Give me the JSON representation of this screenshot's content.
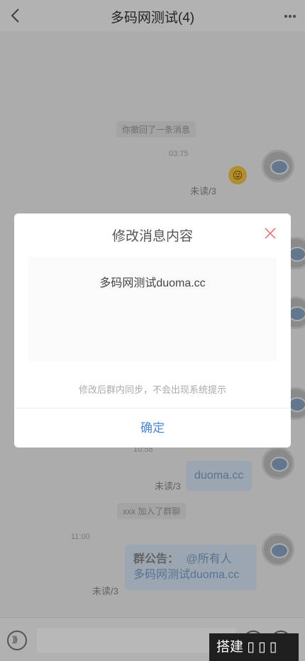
{
  "header": {
    "title": "多码网测试(4)"
  },
  "chat": {
    "system_recall": "你撤回了一条消息",
    "time_1": "03:75",
    "unread_1": "未读/3",
    "emoji_1": "😜",
    "time_2": "10:58",
    "message_2": "duoma.cc",
    "unread_2": "未读/3",
    "system_join": "xxx 加入了群聊",
    "time_3": "11:00",
    "notice_label": "群公告：",
    "notice_mention": "@所有人",
    "notice_text": "多码网测试duoma.cc",
    "unread_3": "未读/3"
  },
  "modal": {
    "title": "修改消息内容",
    "input_value": "多码网测试duoma.cc",
    "hint": "修改后群内同步，不会出现系统提示",
    "confirm_label": "确定"
  },
  "watermark": {
    "text": "搭建 ▯ ▯ ▯"
  },
  "colors": {
    "accent": "#4a86cf",
    "bubble": "#d7e6f6",
    "close": "#e57373"
  }
}
